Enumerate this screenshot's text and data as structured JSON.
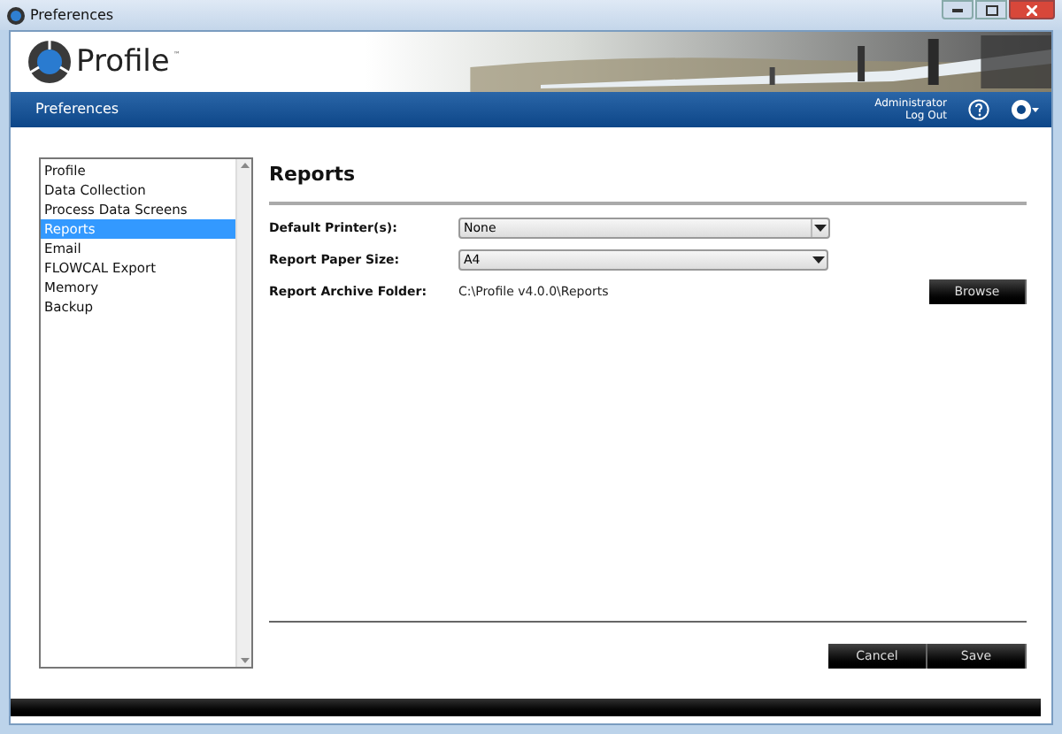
{
  "window": {
    "title": "Preferences"
  },
  "header": {
    "logo_text": "Profile",
    "trademark": "™"
  },
  "nav_bar": {
    "title": "Preferences",
    "user": "Administrator",
    "logout": "Log Out"
  },
  "sidebar": {
    "items": [
      {
        "label": "Profile",
        "selected": false
      },
      {
        "label": "Data Collection",
        "selected": false
      },
      {
        "label": "Process Data Screens",
        "selected": false
      },
      {
        "label": "Reports",
        "selected": true
      },
      {
        "label": "Email",
        "selected": false
      },
      {
        "label": "FLOWCAL Export",
        "selected": false
      },
      {
        "label": "Memory",
        "selected": false
      },
      {
        "label": "Backup",
        "selected": false
      }
    ]
  },
  "panel": {
    "title": "Reports",
    "fields": [
      {
        "kind": "dropdown",
        "label": "Default Printer(s):",
        "value": "None",
        "short": true
      },
      {
        "kind": "dropdown",
        "label": "Report Paper Size:",
        "value": "A4",
        "short": false
      },
      {
        "kind": "path",
        "label": "Report Archive Folder:",
        "value": "C:\\Profile v4.0.0\\Reports",
        "button": "Browse"
      }
    ]
  },
  "buttons": [
    "Cancel",
    "Save"
  ]
}
